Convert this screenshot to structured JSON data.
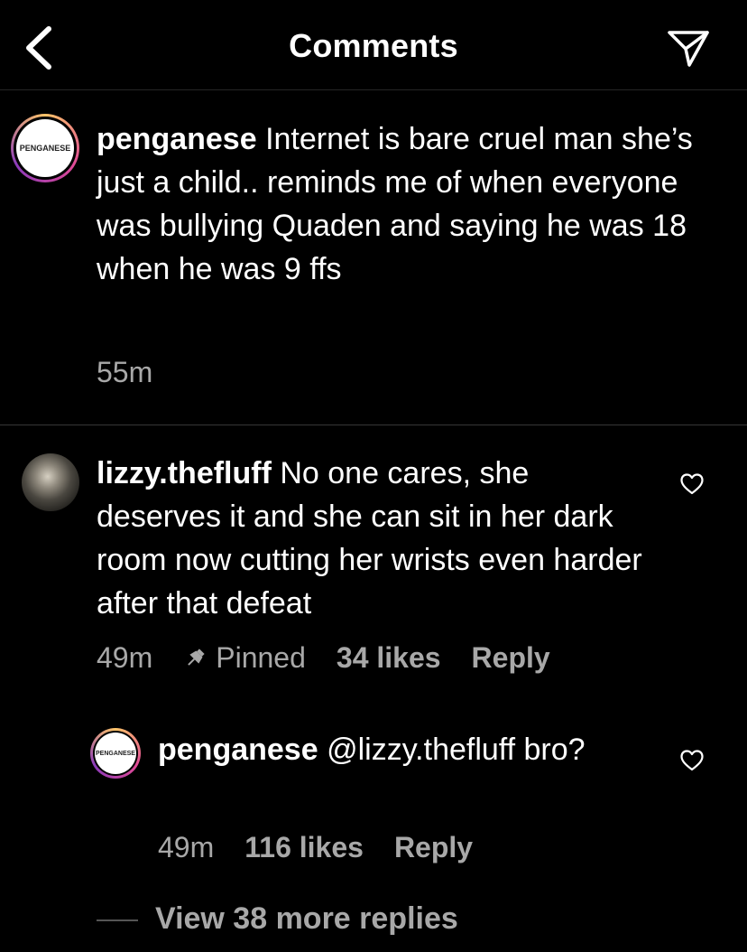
{
  "header": {
    "title": "Comments"
  },
  "comments": [
    {
      "avatar_text": "PENGANESE",
      "username": "penganese",
      "text": " Internet is bare cruel man she’s just a child.. reminds me of when everyone was bullying Quaden and saying he was 18 when he was 9 ffs",
      "time": "55m"
    },
    {
      "username": "lizzy.thefluff",
      "text": " No one cares, she deserves it and she can sit in her dark room now cutting her wrists even harder after that defeat",
      "time": "49m",
      "pinned_label": "Pinned",
      "likes": "34 likes",
      "reply_label": "Reply"
    }
  ],
  "reply": {
    "avatar_text": "PENGANESE",
    "username": "penganese",
    "text": " @lizzy.thefluff bro?",
    "time": "49m",
    "likes": "116 likes",
    "reply_label": "Reply"
  },
  "view_more": "View 38 more replies"
}
